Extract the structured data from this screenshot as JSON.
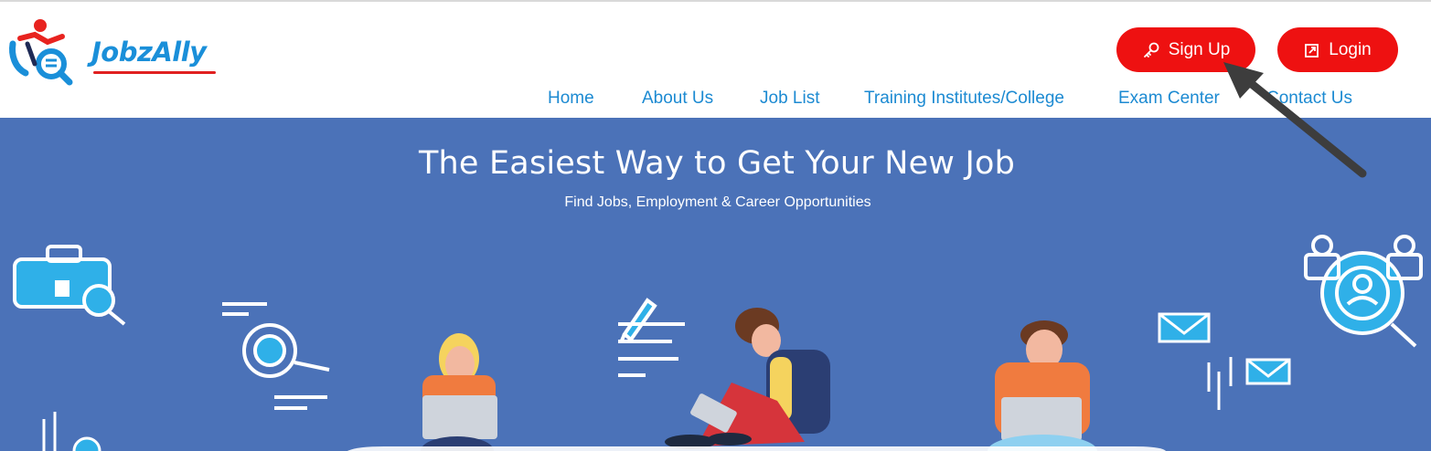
{
  "brand": {
    "name": "JobzAlly"
  },
  "header": {
    "signup_label": "Sign Up",
    "login_label": "Login",
    "nav": [
      {
        "label": "Home"
      },
      {
        "label": "About Us"
      },
      {
        "label": "Job List"
      },
      {
        "label": "Training Institutes/College"
      },
      {
        "label": "Exam Center"
      },
      {
        "label": "Contact Us"
      }
    ]
  },
  "hero": {
    "title": "The Easiest Way to Get Your New Job",
    "subtitle": "Find Jobs, Employment & Career Opportunities"
  },
  "colors": {
    "accent_red": "#ee1111",
    "nav_blue": "#1c8ad2",
    "hero_bg": "#4b72b8"
  },
  "icons": {
    "signup": "key-icon",
    "login": "external-link-icon"
  }
}
